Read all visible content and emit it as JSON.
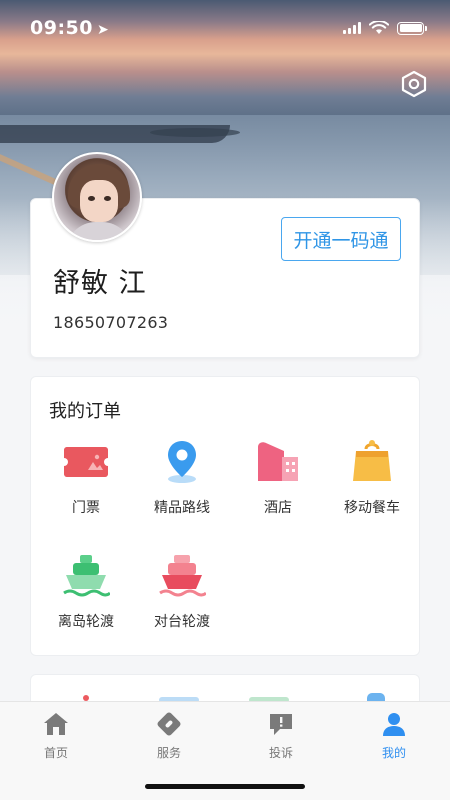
{
  "status_bar": {
    "time": "09:50",
    "location_arrow": "➤"
  },
  "header": {
    "settings_icon": "settings-hexagon-icon"
  },
  "profile": {
    "open_button_label": "开通一码通",
    "name": "舒敏 江",
    "phone": "18650707263"
  },
  "orders": {
    "title": "我的订单",
    "items": [
      {
        "label": "门票",
        "icon": "ticket-icon",
        "color": "#ec5a5f"
      },
      {
        "label": "精品路线",
        "icon": "route-pin-icon",
        "color": "#3aa0ee"
      },
      {
        "label": "酒店",
        "icon": "hotel-icon",
        "color": "#ef6f86"
      },
      {
        "label": "移动餐车",
        "icon": "food-cart-icon",
        "color": "#f6b53c"
      },
      {
        "label": "离岛轮渡",
        "icon": "ferry-green-icon",
        "color": "#3dbf72"
      },
      {
        "label": "对台轮渡",
        "icon": "ferry-red-icon",
        "color": "#ef5e6e"
      }
    ]
  },
  "tabbar": {
    "active_color": "#2f8ff0",
    "tabs": [
      {
        "label": "首页",
        "icon": "home-icon",
        "active": false
      },
      {
        "label": "服务",
        "icon": "service-tag-icon",
        "active": false
      },
      {
        "label": "投诉",
        "icon": "complaint-chat-icon",
        "active": false
      },
      {
        "label": "我的",
        "icon": "profile-user-icon",
        "active": true
      }
    ]
  }
}
